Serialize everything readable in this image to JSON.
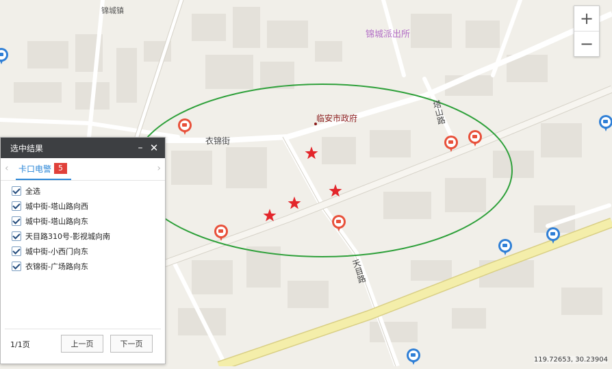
{
  "map": {
    "labels": {
      "town": "锦城镇",
      "police": "锦城派出所",
      "government": "临安市政府",
      "street_yijin": "衣锦街",
      "road_tashan": "塔山路",
      "road_tianmu": "天目路"
    },
    "coordinates": "119.72653, 30.23904",
    "colors": {
      "selection_ellipse": "#2ea03a",
      "star": "#e3262b",
      "camera_red": "#e8503a",
      "camera_blue": "#2f7fd6",
      "main_road": "#f4eeaa"
    },
    "icons": {
      "selected_camera": "star-icon",
      "camera_red": "camera-pin-red-icon",
      "camera_blue": "camera-pin-blue-icon"
    }
  },
  "zoom": {
    "in_label": "+",
    "out_label": "−"
  },
  "panel": {
    "title": "选中结果",
    "minimize_label": "–",
    "close_label": "✕",
    "tab": {
      "label": "卡口电警",
      "count": "5"
    },
    "prev_arrow": "‹",
    "next_arrow": "›",
    "select_all": "全选",
    "items": [
      "城中街-塔山路向西",
      "城中街-塔山路向东",
      "天目路310号-影视城向南",
      "城中街-小西门向东",
      "衣锦街-广场路向东"
    ],
    "page_info": "1/1页",
    "prev_button": "上一页",
    "next_button": "下一页"
  }
}
